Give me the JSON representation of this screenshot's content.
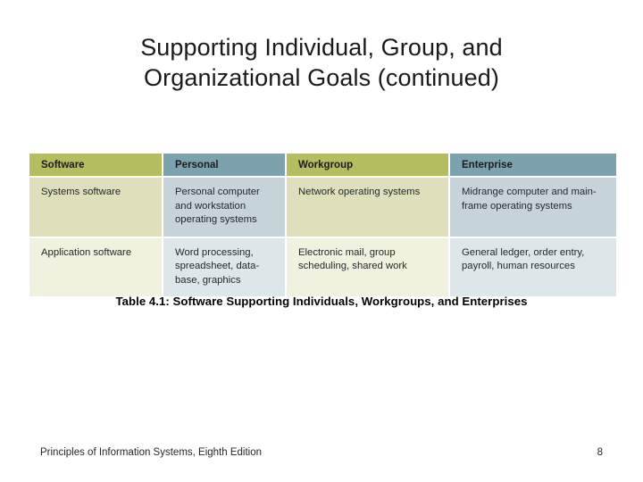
{
  "slide": {
    "title_line1": "Supporting Individual, Group, and",
    "title_line2": "Organizational Goals (continued)",
    "caption": "Table 4.1: Software Supporting Individuals, Workgroups, and Enterprises"
  },
  "table": {
    "headers": [
      {
        "label": "Software",
        "tone": "olive"
      },
      {
        "label": "Personal",
        "tone": "blue"
      },
      {
        "label": "Workgroup",
        "tone": "olive"
      },
      {
        "label": "Enterprise",
        "tone": "blue"
      }
    ],
    "rows": [
      {
        "cells": [
          "Systems software",
          "Personal computer and workstation operating systems",
          "Network operating systems",
          "Midrange computer and main-frame operating systems"
        ]
      },
      {
        "cells": [
          "Application software",
          "Word processing, spreadsheet, data-base, graphics",
          "Electronic mail, group scheduling, shared work",
          "General ledger, order entry, payroll, human resources"
        ]
      }
    ]
  },
  "footer": {
    "source": "Principles of Information Systems, Eighth Edition",
    "page": "8"
  },
  "colors": {
    "header_olive": "#b4bd5f",
    "header_blue": "#7ba2ad",
    "row1_cream": "#dfdfbb",
    "row1_blue": "#c6d4da",
    "row2_cream": "#f1f1e0",
    "row2_blue": "#dde6e9",
    "background": "#ffffff",
    "text": "#1a1a1a"
  }
}
